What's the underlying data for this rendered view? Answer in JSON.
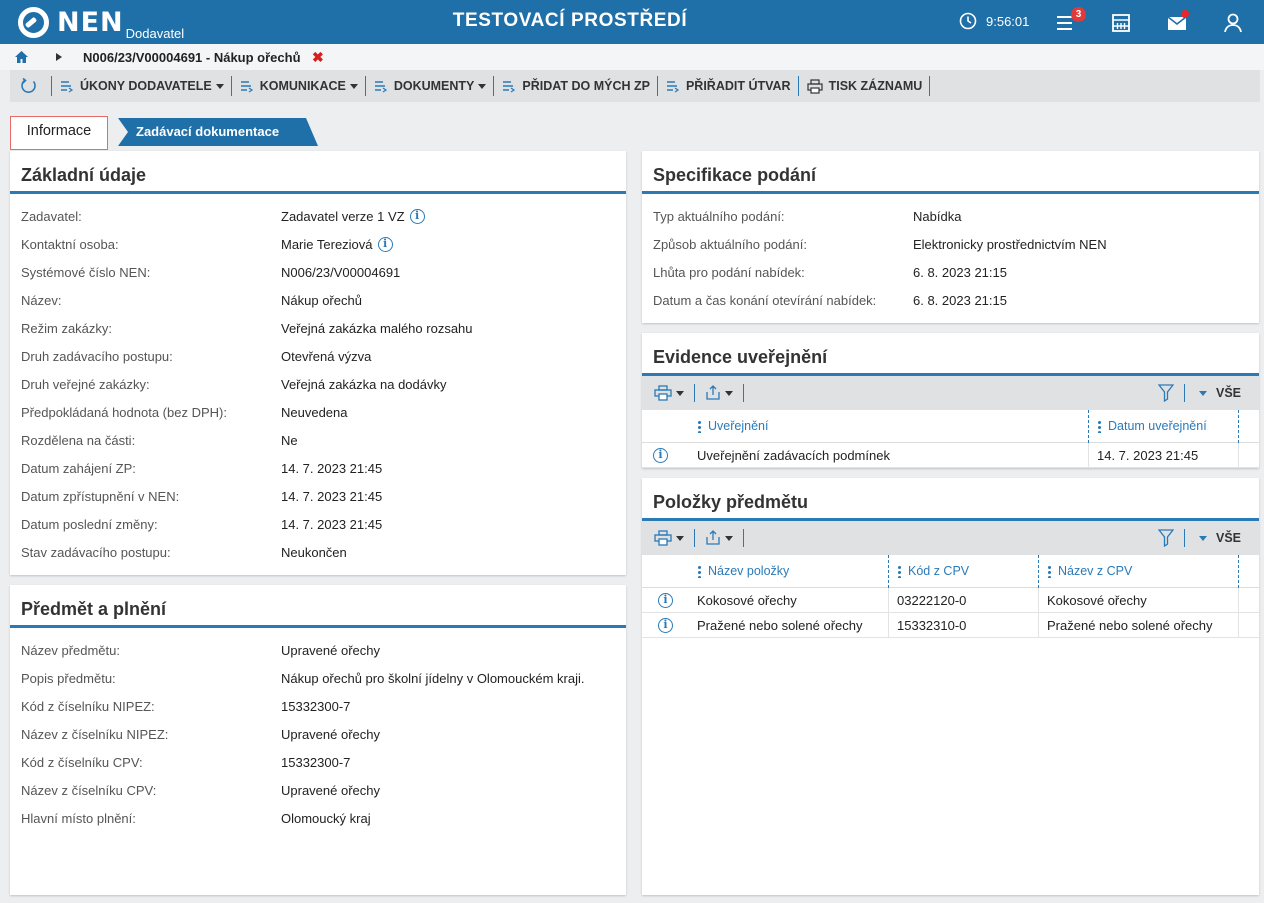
{
  "header": {
    "logo_text": "NEN",
    "logo_sub": "Dodavatel",
    "env_title": "TESTOVACÍ PROSTŘEDÍ",
    "clock": "9:56:01",
    "notifications_count": "3"
  },
  "breadcrumb": {
    "current": "N006/23/V00004691 - Nákup ořechů",
    "close_symbol": "✖"
  },
  "toolbar": {
    "items": [
      {
        "label": "ÚKONY DODAVATELE",
        "dropdown": true
      },
      {
        "label": "KOMUNIKACE",
        "dropdown": true
      },
      {
        "label": "DOKUMENTY",
        "dropdown": true
      },
      {
        "label": "PŘIDAT DO MÝCH ZP",
        "dropdown": false
      },
      {
        "label": "PŘIŘADIT ÚTVAR",
        "dropdown": false
      },
      {
        "label": "TISK ZÁZNAMU",
        "dropdown": false
      }
    ]
  },
  "tabs": {
    "info": "Informace",
    "docs": "Zadávací dokumentace"
  },
  "basic": {
    "title": "Základní údaje",
    "rows": [
      {
        "label": "Zadavatel:",
        "value": "Zadavatel verze 1 VZ",
        "info": true
      },
      {
        "label": "Kontaktní osoba:",
        "value": "Marie  Tereziová",
        "info": true
      },
      {
        "label": "Systémové číslo NEN:",
        "value": "N006/23/V00004691",
        "info": false
      },
      {
        "label": "Název:",
        "value": "Nákup ořechů",
        "info": false
      },
      {
        "label": "Režim zakázky:",
        "value": "Veřejná zakázka malého rozsahu",
        "info": false
      },
      {
        "label": "Druh zadávacího postupu:",
        "value": "Otevřená výzva",
        "info": false
      },
      {
        "label": "Druh veřejné zakázky:",
        "value": "Veřejná zakázka na dodávky",
        "info": false
      },
      {
        "label": "Předpokládaná hodnota (bez DPH):",
        "value": "Neuvedena",
        "info": false
      },
      {
        "label": "Rozdělena na části:",
        "value": "Ne",
        "info": false
      },
      {
        "label": "Datum zahájení ZP:",
        "value": "14. 7. 2023 21:45",
        "info": false
      },
      {
        "label": "Datum zpřístupnění v NEN:",
        "value": "14. 7. 2023 21:45",
        "info": false
      },
      {
        "label": "Datum poslední změny:",
        "value": "14. 7. 2023 21:45",
        "info": false
      },
      {
        "label": "Stav zadávacího postupu:",
        "value": "Neukončen",
        "info": false
      }
    ]
  },
  "subject": {
    "title": "Předmět a plnění",
    "rows": [
      {
        "label": "Název předmětu:",
        "value": "Upravené ořechy"
      },
      {
        "label": "Popis předmětu:",
        "value": "Nákup ořechů pro školní jídelny v Olomouckém kraji."
      },
      {
        "label": "Kód z číselníku NIPEZ:",
        "value": "15332300-7"
      },
      {
        "label": "Název z číselníku NIPEZ:",
        "value": "Upravené ořechy"
      },
      {
        "label": "Kód z číselníku CPV:",
        "value": "15332300-7"
      },
      {
        "label": "Název z číselníku CPV:",
        "value": "Upravené ořechy"
      },
      {
        "label": "Hlavní místo plnění:",
        "value": "Olomoucký kraj"
      }
    ]
  },
  "spec": {
    "title": "Specifikace podání",
    "rows": [
      {
        "label": "Typ aktuálního podání:",
        "value": "Nabídka"
      },
      {
        "label": "Způsob aktuálního podání:",
        "value": "Elektronicky prostřednictvím NEN"
      },
      {
        "label": "Lhůta pro podání nabídek:",
        "value": "6. 8. 2023 21:15"
      },
      {
        "label": "Datum a čas konání otevírání nabídek:",
        "value": "6. 8. 2023 21:15"
      }
    ]
  },
  "evidence": {
    "title": "Evidence uveřejnění",
    "filter_label": "VŠE",
    "columns": [
      "Uveřejnění",
      "Datum uveřejnění"
    ],
    "rows": [
      [
        "Uveřejnění zadávacích podmínek",
        "14. 7. 2023 21:45"
      ]
    ]
  },
  "items": {
    "title": "Položky předmětu",
    "filter_label": "VŠE",
    "columns": [
      "Název položky",
      "Kód z CPV",
      "Název z CPV"
    ],
    "rows": [
      [
        "Kokosové ořechy",
        "03222120-0",
        "Kokosové ořechy"
      ],
      [
        "Pražené nebo solené ořechy",
        "15332310-0",
        "Pražené nebo solené ořechy"
      ]
    ]
  }
}
